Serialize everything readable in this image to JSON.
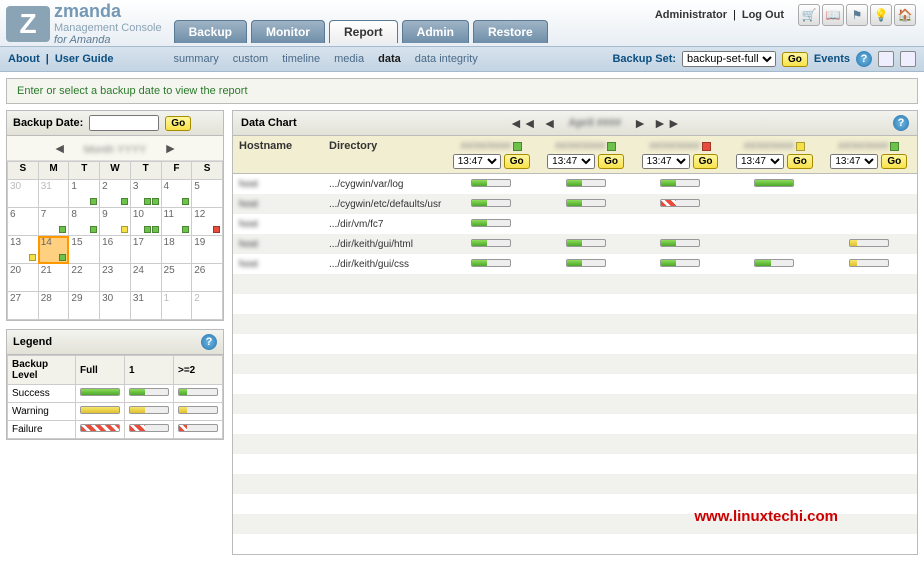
{
  "header": {
    "brand_line1": "zmanda",
    "brand_line2": "Management Console",
    "brand_line3": "for Amanda",
    "user": "Administrator",
    "logout": "Log Out"
  },
  "tabs": [
    "Backup",
    "Monitor",
    "Report",
    "Admin",
    "Restore"
  ],
  "active_tab": "Report",
  "subtabs": [
    "summary",
    "custom",
    "timeline",
    "media",
    "data",
    "data integrity"
  ],
  "active_subtab": "data",
  "left_links": [
    "About",
    "User Guide"
  ],
  "backup_set": {
    "label": "Backup Set:",
    "value": "backup-set-full",
    "go": "Go",
    "events": "Events"
  },
  "message": "Enter or select a backup date to view the report",
  "backup_date": {
    "label": "Backup Date:",
    "value": "",
    "go": "Go"
  },
  "calendar": {
    "dow": [
      "S",
      "M",
      "T",
      "W",
      "T",
      "F",
      "S"
    ],
    "cells": [
      [
        {
          "n": 30,
          "dim": true
        },
        {
          "n": 31,
          "dim": true
        },
        {
          "n": 1,
          "m": [
            "g"
          ]
        },
        {
          "n": 2,
          "m": [
            "g"
          ]
        },
        {
          "n": 3,
          "m": [
            "g",
            "g"
          ]
        },
        {
          "n": 4,
          "m": [
            "g"
          ]
        },
        {
          "n": 5
        }
      ],
      [
        {
          "n": 6
        },
        {
          "n": 7,
          "m": [
            "g"
          ]
        },
        {
          "n": 8,
          "m": [
            "g"
          ]
        },
        {
          "n": 9,
          "m": [
            "y"
          ]
        },
        {
          "n": 10,
          "m": [
            "g",
            "g"
          ]
        },
        {
          "n": 11,
          "m": [
            "g"
          ]
        },
        {
          "n": 12,
          "m": [
            "r"
          ]
        }
      ],
      [
        {
          "n": 13,
          "m": [
            "y"
          ]
        },
        {
          "n": 14,
          "sel": true,
          "m": [
            "g"
          ]
        },
        {
          "n": 15
        },
        {
          "n": 16
        },
        {
          "n": 17
        },
        {
          "n": 18
        },
        {
          "n": 19
        }
      ],
      [
        {
          "n": 20
        },
        {
          "n": 21
        },
        {
          "n": 22
        },
        {
          "n": 23
        },
        {
          "n": 24
        },
        {
          "n": 25
        },
        {
          "n": 26
        }
      ],
      [
        {
          "n": 27
        },
        {
          "n": 28
        },
        {
          "n": 29
        },
        {
          "n": 30
        },
        {
          "n": 31
        },
        {
          "n": 1,
          "dim": true
        },
        {
          "n": 2,
          "dim": true
        }
      ]
    ]
  },
  "legend": {
    "title": "Legend",
    "headers": [
      "Backup Level",
      "Full",
      "1",
      ">=2"
    ],
    "rows": [
      {
        "label": "Success",
        "cells": [
          "full",
          "half",
          "small"
        ]
      },
      {
        "label": "Warning",
        "cells": [
          "yfull",
          "yhalf",
          "ysmall"
        ]
      },
      {
        "label": "Failure",
        "cells": [
          "rfull",
          "rhalf",
          "rsmall"
        ]
      }
    ]
  },
  "chart": {
    "title": "Data Chart",
    "col_hostname": "Hostname",
    "col_directory": "Directory",
    "go": "Go",
    "time": "13:47",
    "date_marks": [
      "g",
      "g",
      "r",
      "y",
      "g"
    ],
    "rows": [
      {
        "dir": ".../cygwin/var/log",
        "cells": [
          "half",
          "half",
          "half",
          "full",
          ""
        ]
      },
      {
        "dir": ".../cygwin/etc/defaults/usr",
        "cells": [
          "half",
          "half",
          "rhalf",
          "",
          ""
        ]
      },
      {
        "dir": ".../dir/vm/fc7",
        "cells": [
          "half",
          "",
          "",
          "",
          ""
        ]
      },
      {
        "dir": ".../dir/keith/gui/html",
        "cells": [
          "half",
          "half",
          "half",
          "",
          "ysmall"
        ]
      },
      {
        "dir": ".../dir/keith/gui/css",
        "cells": [
          "half",
          "half",
          "half",
          "half",
          "ysmall"
        ]
      }
    ]
  },
  "watermark": "www.linuxtechi.com"
}
